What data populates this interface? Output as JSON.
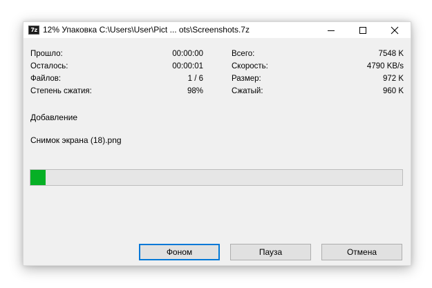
{
  "window": {
    "title": "12% Упаковка C:\\Users\\User\\Pict ... ots\\Screenshots.7z",
    "icon_text": "7z",
    "icon": "7zip-icon"
  },
  "title_buttons": {
    "minimize_icon": "minimize-icon",
    "maximize_icon": "maximize-icon",
    "close_icon": "close-icon"
  },
  "stats_left": [
    {
      "label": "Прошло:",
      "value": "00:00:00"
    },
    {
      "label": "Осталось:",
      "value": "00:00:01"
    },
    {
      "label": "Файлов:",
      "value": "1 / 6"
    },
    {
      "label": "Степень сжатия:",
      "value": "98%"
    }
  ],
  "stats_right": [
    {
      "label": "Всего:",
      "value": "7548 K"
    },
    {
      "label": "Скорость:",
      "value": "4790 KB/s"
    },
    {
      "label": "Размер:",
      "value": "972 K"
    },
    {
      "label": "Сжатый:",
      "value": "960 K"
    }
  ],
  "operation": "Добавление",
  "current_file": "Снимок экрана (18).png",
  "progress": {
    "percent": 12,
    "bar_fill_fraction": 0.04,
    "color": "#06b025"
  },
  "buttons": {
    "background": "Фоном",
    "pause": "Пауза",
    "cancel": "Отмена"
  }
}
